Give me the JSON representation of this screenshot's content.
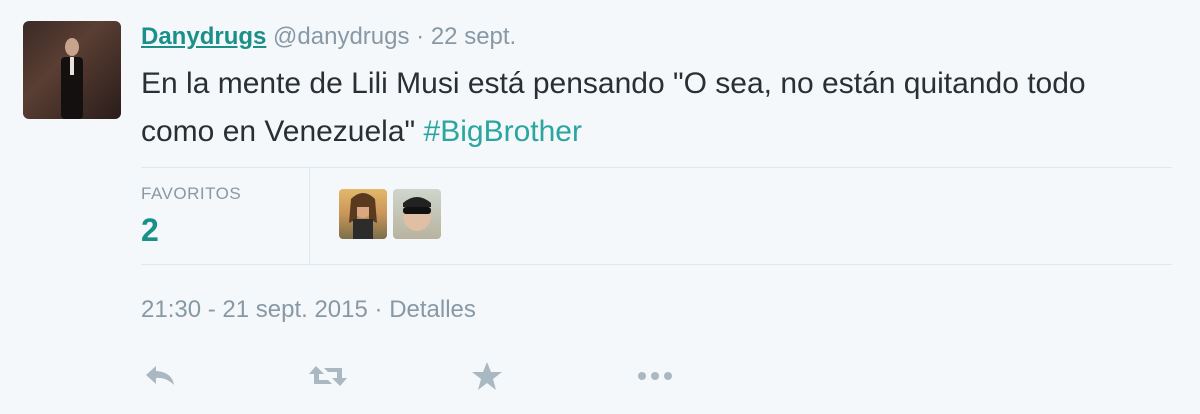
{
  "tweet": {
    "fullname": "Danydrugs",
    "username": "@danydrugs",
    "separator": "·",
    "date": "22 sept.",
    "text_main": "En la mente de Lili Musi está pensando \"O sea, no están quitando todo como en Venezuela\"",
    "hashtag": "#BigBrother"
  },
  "stats": {
    "favorites_label": "FAVORITOS",
    "favorites_count": "2"
  },
  "footer": {
    "timestamp": "21:30 - 21 sept. 2015",
    "separator": "·",
    "details_link": "Detalles"
  },
  "actions": {
    "reply": "reply-icon",
    "retweet": "retweet-icon",
    "favorite": "star-icon",
    "more": "more-icon"
  },
  "colors": {
    "background": "#f5f8fa",
    "accent": "#1b8f8a",
    "hashtag": "#2aa59f",
    "muted": "#8899a6",
    "icon": "#aab8c2"
  }
}
